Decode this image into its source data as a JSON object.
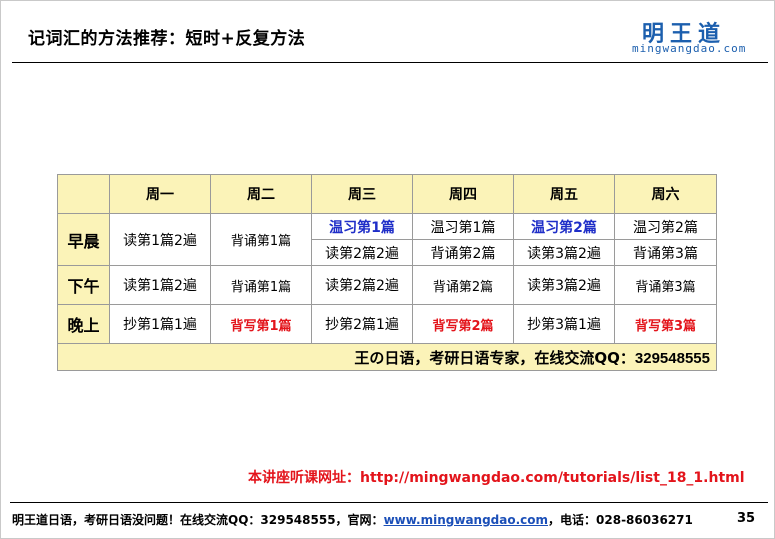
{
  "slide": {
    "title": "记词汇的方法推荐：短时+反复方法",
    "page_number": "35"
  },
  "logo": {
    "cn": "明王道",
    "en": "mingwangdao.com"
  },
  "table": {
    "days": [
      "周一",
      "周二",
      "周三",
      "周四",
      "周五",
      "周六"
    ],
    "rows": {
      "morning": {
        "label": "早晨",
        "mon": "读第1篇2遍",
        "tue": "背诵第1篇",
        "wed_top": "温习第1篇",
        "wed_bottom": "读第2篇2遍",
        "thu_top": "温习第1篇",
        "thu_bottom": "背诵第2篇",
        "fri_top": "温习第2篇",
        "fri_bottom": "读第3篇2遍",
        "sat_top": "温习第2篇",
        "sat_bottom": "背诵第3篇"
      },
      "afternoon": {
        "label": "下午",
        "mon": "读第1篇2遍",
        "tue": "背诵第1篇",
        "wed": "读第2篇2遍",
        "thu": "背诵第2篇",
        "fri": "读第3篇2遍",
        "sat": "背诵第3篇"
      },
      "evening": {
        "label": "晚上",
        "mon": "抄第1篇1遍",
        "tue": "背写第1篇",
        "wed": "抄第2篇1遍",
        "thu": "背写第2篇",
        "fri": "抄第3篇1遍",
        "sat": "背写第3篇"
      }
    },
    "footer_text": "王の日语，考研日语专家，在线交流QQ：",
    "footer_qq": "329548555"
  },
  "lecture_link": "本讲座听课网址：http://mingwangdao.com/tutorials/list_18_1.html",
  "footer": {
    "prefix": "明王道日语，考研日语没问题！在线交流QQ：329548555，官网：",
    "site": "www.mingwangdao.com",
    "suffix": "，电话：028-86036271"
  },
  "colors": {
    "header_fill": "#fbf3b8",
    "highlight_blue": "#1f2ec8",
    "highlight_red": "#e3141b",
    "logo_blue": "#1c5fae"
  }
}
